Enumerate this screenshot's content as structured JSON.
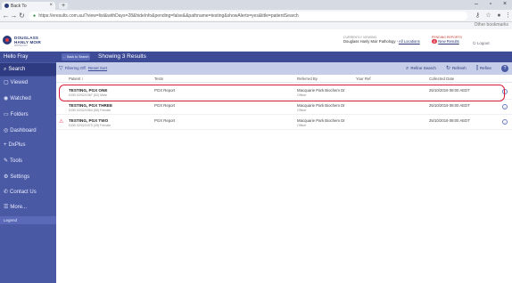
{
  "browser": {
    "tab_title": "Back To",
    "url": "https://eresults.com.au/?view=list&withDays=28&hideInfo&pending=false&&pathname=testing&showAlerts=yes&title=patientSearch",
    "tab_close": "×",
    "new_tab": "+",
    "back": "←",
    "forward": "→",
    "reload": "↻",
    "bookmarks_label": "Other bookmarks"
  },
  "header": {
    "logo_line1": "DOUGLASS",
    "logo_line2": "HANLY MOIR",
    "logo_line3": "PATHOLOGY",
    "current_view_caption": "CURRENTLY VIEWING",
    "current_view_value": "Douglass Hanly Moir Pathology - ",
    "current_view_link": "All Locations",
    "pending_caption": "PENDING REPORTS",
    "pending_count": "0",
    "pending_link": "New Results",
    "logout": "Logout"
  },
  "sidebar": {
    "title": "Hello Fray",
    "items": [
      {
        "icon": "search-icon",
        "glyph": "⌕",
        "label": "Search"
      },
      {
        "icon": "eye-icon",
        "glyph": "▢",
        "label": "Viewed"
      },
      {
        "icon": "watched-icon",
        "glyph": "◉",
        "label": "Watched"
      },
      {
        "icon": "folder-icon",
        "glyph": "▭",
        "label": "Folders"
      },
      {
        "icon": "dashboard-icon",
        "glyph": "◎",
        "label": "Dashboard"
      },
      {
        "icon": "plus-icon",
        "glyph": "+",
        "label": "DxPlus"
      },
      {
        "icon": "tools-icon",
        "glyph": "✎",
        "label": "Tools"
      },
      {
        "icon": "gear-icon",
        "glyph": "⚙",
        "label": "Settings"
      },
      {
        "icon": "phone-icon",
        "glyph": "✆",
        "label": "Contact Us"
      },
      {
        "icon": "more-icon",
        "glyph": "☰",
        "label": "More..."
      }
    ],
    "legend": "Legend"
  },
  "topbar": {
    "back_label": "Back to Search",
    "results_text": "Showing 3 Results"
  },
  "toolbar": {
    "filter_label": "Filtering Off",
    "reset_label": "Reset Sort",
    "refine_search": "Refine Search",
    "refresh": "Refresh",
    "refine": "Refine",
    "help": "?"
  },
  "table": {
    "headers": [
      "Patient",
      "Tests",
      "Referred By",
      "Your Ref",
      "Collected Date"
    ],
    "rows": [
      {
        "name": "TESTING, PGX ONE",
        "sub": "DOB 02/02/1967 (52) Male",
        "tests": "PGX Report",
        "referred": "Macquarie Park Biochem Dr",
        "referred_sub": "Officer",
        "ref": "",
        "date": "25/10/2019 08:00 AEDT",
        "warn": false
      },
      {
        "name": "TESTING, PGX THREE",
        "sub": "DOB 02/02/1964 (55) Female",
        "tests": "PGX Report",
        "referred": "Macquarie Park Biochem Dr",
        "referred_sub": "Officer",
        "ref": "",
        "date": "25/10/2019 08:00 AEDT",
        "warn": false
      },
      {
        "name": "TESTING, PGX TWO",
        "sub": "DOB 02/02/1970 (49) Female",
        "tests": "PGX Report",
        "referred": "Macquarie Park Biochem Dr",
        "referred_sub": "Officer",
        "ref": "",
        "date": "25/10/2019 08:00 AEDT",
        "warn": true
      }
    ]
  }
}
